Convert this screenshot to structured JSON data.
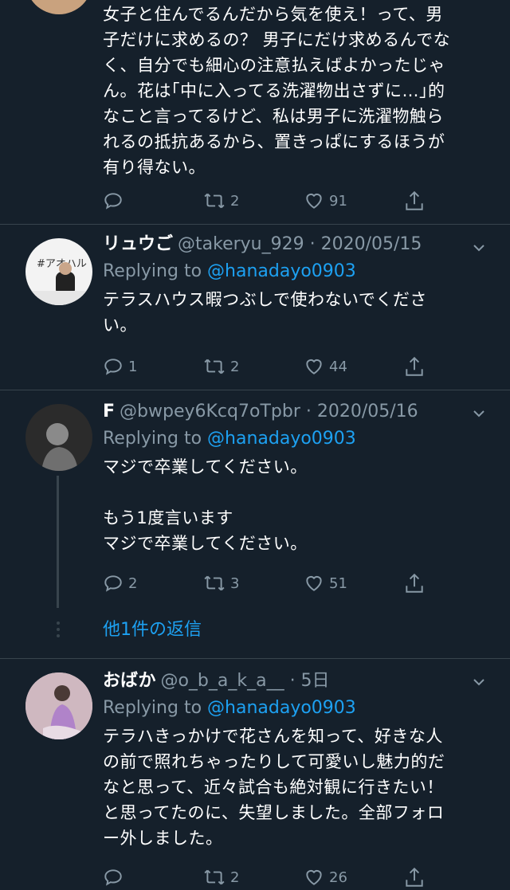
{
  "tweet_top": {
    "body_lines": [
      "女子と住んでるんだから気を使え！って、男",
      "子だけに求めるの？ 男子にだけ求めるんでな",
      "く、自分でも細心の注意払えばよかったじゃ",
      "ん。花は｢中に入ってる洗濯物出さずに…｣的",
      "なこと言ってるけど、私は男子に洗濯物触ら",
      "れるの抵抗あるから、置きっぱにするほうが",
      "有り得ない。"
    ],
    "retweets": "2",
    "likes": "91"
  },
  "tweet_ryugo": {
    "name": "リュウご",
    "handle_date": "@takeryu_929 · 2020/05/15",
    "replying_prefix": "Replying to",
    "replying_to": "@hanadayo0903",
    "body_lines": [
      "テラスハウス暇つぶしで使わないでくださ",
      "い。"
    ],
    "replies": "1",
    "retweets": "2",
    "likes": "44",
    "avatar_text": "#アオハル"
  },
  "tweet_f": {
    "name": "F",
    "handle_date": "@bwpey6Kcq7oTpbr · 2020/05/16",
    "replying_prefix": "Replying to",
    "replying_to": "@hanadayo0903",
    "body_lines": [
      "マジで卒業してください。",
      "",
      "もう1度言います",
      "マジで卒業してください。"
    ],
    "replies": "2",
    "retweets": "3",
    "likes": "51",
    "more_replies": "他1件の返信"
  },
  "tweet_obaka": {
    "name": "おばか",
    "handle_date": "@o_b_a_k_a__ · 5日",
    "replying_prefix": "Replying to",
    "replying_to": "@hanadayo0903",
    "body_lines": [
      "テラハきっかけで花さんを知って、好きな人",
      "の前で照れちゃったりして可愛いし魅力的だ",
      "なと思って、近々試合も絶対観に行きたい！",
      "と思ってたのに、失望しました。全部フォロ",
      "ー外しました。"
    ],
    "retweets": "2",
    "likes": "26"
  },
  "icons": [
    "reply-icon",
    "retweet-icon",
    "like-icon",
    "share-icon",
    "chevron-down-icon",
    "thread-dots-icon"
  ],
  "colors": {
    "background": "#15202b",
    "text": "#ffffff",
    "secondary": "#8899a6",
    "link": "#1da1f2",
    "divider": "#38444d"
  }
}
